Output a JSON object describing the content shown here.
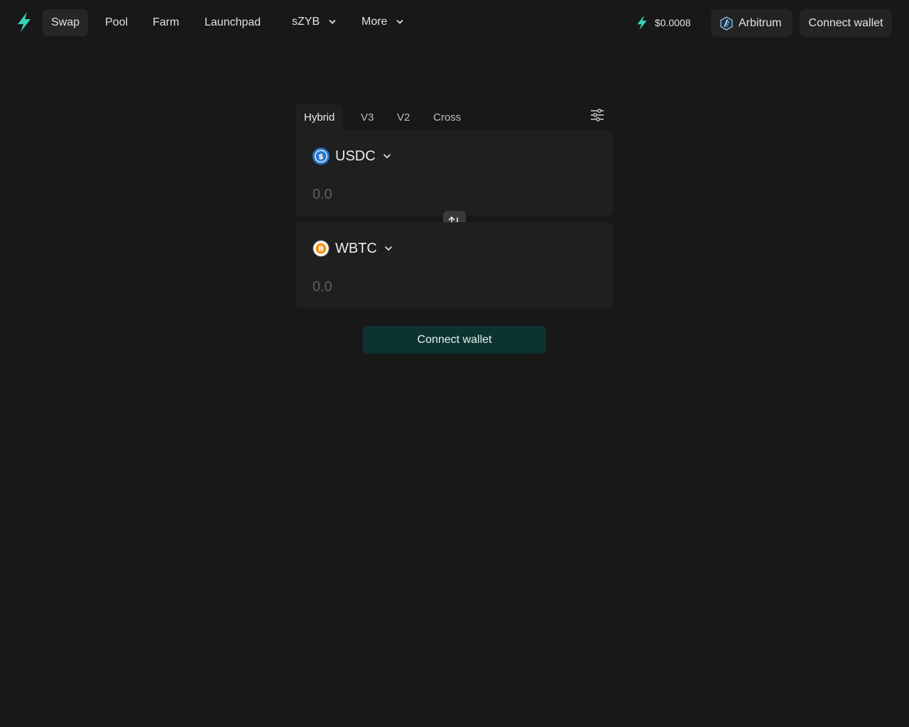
{
  "colors": {
    "background": "#181818",
    "panel": "#1f1f1f",
    "accent": "#3ad2b6",
    "connect_button_bg": "#0c3330"
  },
  "header": {
    "logo_icon": "lightning-bolt-icon",
    "nav": [
      {
        "label": "Swap",
        "active": true
      },
      {
        "label": "Pool",
        "active": false
      },
      {
        "label": "Farm",
        "active": false
      },
      {
        "label": "Launchpad",
        "active": false
      },
      {
        "label": "sZYB",
        "active": false,
        "dropdown": true
      },
      {
        "label": "More",
        "active": false,
        "dropdown": true
      }
    ],
    "token_price": "$0.0008",
    "network": {
      "label": "Arbitrum",
      "icon": "arbitrum-icon"
    },
    "connect_label": "Connect wallet"
  },
  "swap": {
    "tabs": [
      {
        "label": "Hybrid",
        "active": true
      },
      {
        "label": "V3",
        "active": false
      },
      {
        "label": "V2",
        "active": false
      },
      {
        "label": "Cross",
        "active": false
      }
    ],
    "settings_icon": "sliders-icon",
    "from": {
      "symbol": "USDC",
      "icon": "usdc-icon",
      "placeholder": "0.0"
    },
    "to": {
      "symbol": "WBTC",
      "icon": "bitcoin-icon",
      "placeholder": "0.0"
    },
    "switch_icon": "swap-arrows-icon",
    "connect_label": "Connect wallet"
  }
}
